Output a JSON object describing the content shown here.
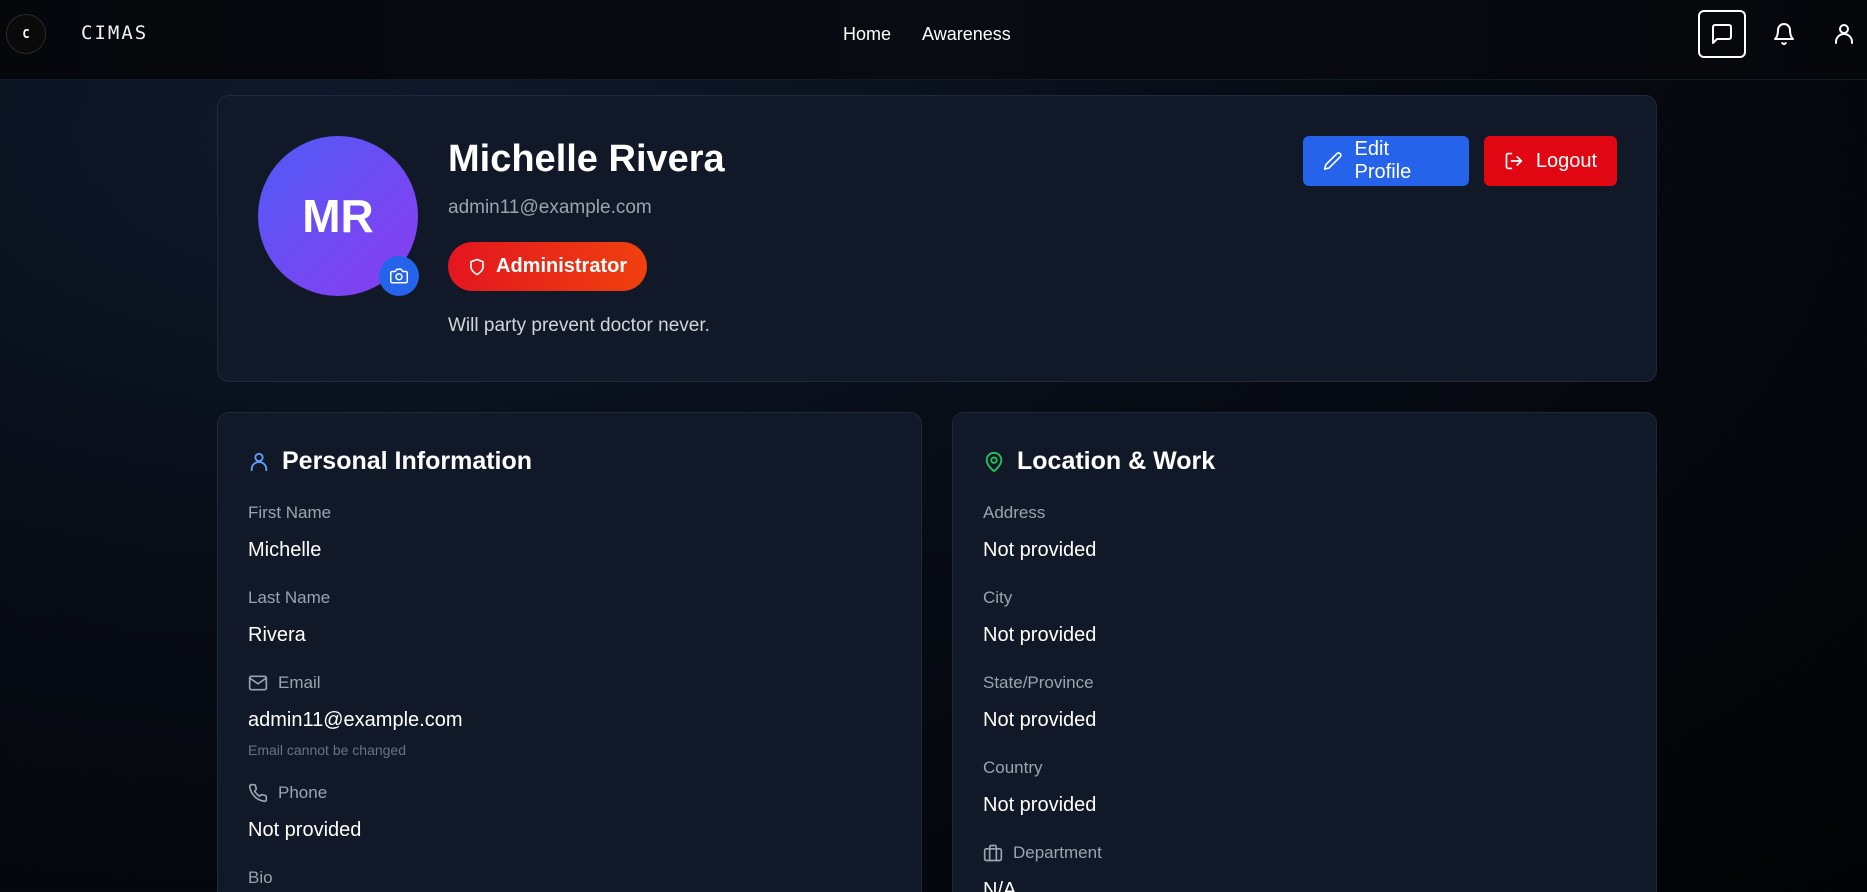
{
  "nav": {
    "logo_letter": "C",
    "brand": "CIMAS",
    "links": [
      "Home",
      "Awareness"
    ],
    "icons": [
      "chat-icon",
      "bell-icon",
      "user-icon"
    ]
  },
  "profile": {
    "initials": "MR",
    "name": "Michelle Rivera",
    "email": "admin11@example.com",
    "role": "Administrator",
    "bio": "Will party prevent doctor never.",
    "edit_label": "Edit Profile",
    "logout_label": "Logout"
  },
  "personal": {
    "title": "Personal Information",
    "first_name_label": "First Name",
    "first_name": "Michelle",
    "last_name_label": "Last Name",
    "last_name": "Rivera",
    "email_label": "Email",
    "email": "admin11@example.com",
    "email_note": "Email cannot be changed",
    "phone_label": "Phone",
    "phone": "Not provided",
    "bio_label": "Bio"
  },
  "location": {
    "title": "Location & Work",
    "address_label": "Address",
    "address": "Not provided",
    "city_label": "City",
    "city": "Not provided",
    "state_label": "State/Province",
    "state": "Not provided",
    "country_label": "Country",
    "country": "Not provided",
    "department_label": "Department",
    "department": "N/A"
  },
  "colors": {
    "accent_blue": "#2563eb",
    "danger_red": "#e10712",
    "card_bg": "#111827",
    "personal_icon": "#60a5fa",
    "location_icon": "#22c55e"
  }
}
